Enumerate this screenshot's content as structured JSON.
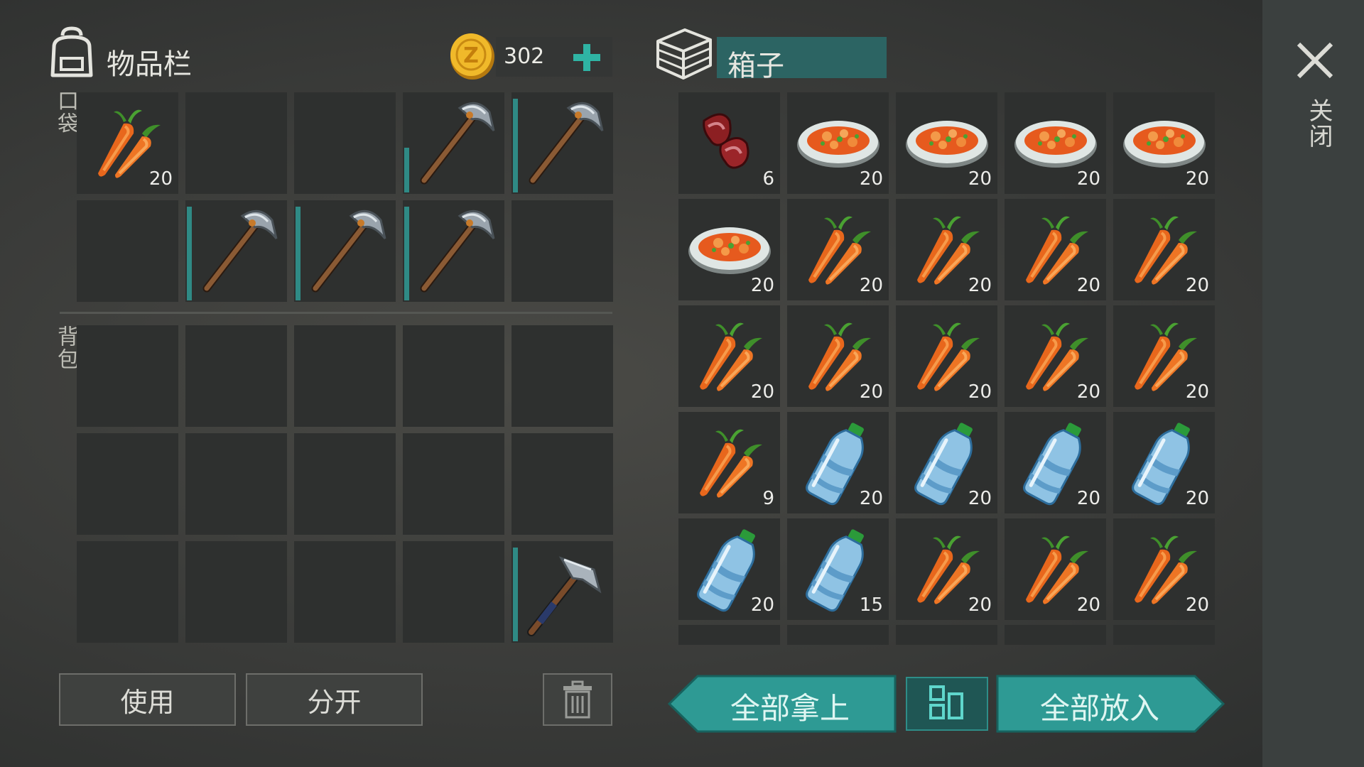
{
  "inventory": {
    "title": "物品栏",
    "coins": "302",
    "pocket_label": "口袋",
    "backpack_label": "背包",
    "pocket_slots": [
      {
        "item": "carrot",
        "count": "20",
        "durability": null
      },
      {
        "item": "empty",
        "count": "",
        "durability": null
      },
      {
        "item": "empty",
        "count": "",
        "durability": null
      },
      {
        "item": "pickaxe",
        "count": "",
        "durability": 0.45
      },
      {
        "item": "pickaxe",
        "count": "",
        "durability": 0.95
      },
      {
        "item": "empty",
        "count": "",
        "durability": null
      },
      {
        "item": "pickaxe",
        "count": "",
        "durability": 0.95
      },
      {
        "item": "pickaxe",
        "count": "",
        "durability": 0.95
      },
      {
        "item": "pickaxe",
        "count": "",
        "durability": 0.95
      },
      {
        "item": "empty",
        "count": "",
        "durability": null
      }
    ],
    "backpack_slots": [
      {
        "item": "empty",
        "count": "",
        "durability": null
      },
      {
        "item": "empty",
        "count": "",
        "durability": null
      },
      {
        "item": "empty",
        "count": "",
        "durability": null
      },
      {
        "item": "empty",
        "count": "",
        "durability": null
      },
      {
        "item": "empty",
        "count": "",
        "durability": null
      },
      {
        "item": "empty",
        "count": "",
        "durability": null
      },
      {
        "item": "empty",
        "count": "",
        "durability": null
      },
      {
        "item": "empty",
        "count": "",
        "durability": null
      },
      {
        "item": "empty",
        "count": "",
        "durability": null
      },
      {
        "item": "empty",
        "count": "",
        "durability": null
      },
      {
        "item": "empty",
        "count": "",
        "durability": null
      },
      {
        "item": "empty",
        "count": "",
        "durability": null
      },
      {
        "item": "empty",
        "count": "",
        "durability": null
      },
      {
        "item": "empty",
        "count": "",
        "durability": null
      },
      {
        "item": "hammer",
        "count": "",
        "durability": 0.95
      }
    ],
    "use_label": "使用",
    "split_label": "分开"
  },
  "chest": {
    "title": "箱子",
    "slots": [
      {
        "item": "meat",
        "count": "6"
      },
      {
        "item": "stew",
        "count": "20"
      },
      {
        "item": "stew",
        "count": "20"
      },
      {
        "item": "stew",
        "count": "20"
      },
      {
        "item": "stew",
        "count": "20"
      },
      {
        "item": "stew",
        "count": "20"
      },
      {
        "item": "carrot",
        "count": "20"
      },
      {
        "item": "carrot",
        "count": "20"
      },
      {
        "item": "carrot",
        "count": "20"
      },
      {
        "item": "carrot",
        "count": "20"
      },
      {
        "item": "carrot",
        "count": "20"
      },
      {
        "item": "carrot",
        "count": "20"
      },
      {
        "item": "carrot",
        "count": "20"
      },
      {
        "item": "carrot",
        "count": "20"
      },
      {
        "item": "carrot",
        "count": "20"
      },
      {
        "item": "carrot",
        "count": "9"
      },
      {
        "item": "water",
        "count": "20"
      },
      {
        "item": "water",
        "count": "20"
      },
      {
        "item": "water",
        "count": "20"
      },
      {
        "item": "water",
        "count": "20"
      },
      {
        "item": "water",
        "count": "20"
      },
      {
        "item": "water",
        "count": "15"
      },
      {
        "item": "carrot",
        "count": "20"
      },
      {
        "item": "carrot",
        "count": "20"
      },
      {
        "item": "carrot",
        "count": "20"
      }
    ],
    "take_all_label": "全部拿上",
    "put_all_label": "全部放入"
  },
  "close_label": "关闭",
  "colors": {
    "accent": "#2f8a85",
    "slot": "#2e302f",
    "background": "#3a3b39"
  }
}
